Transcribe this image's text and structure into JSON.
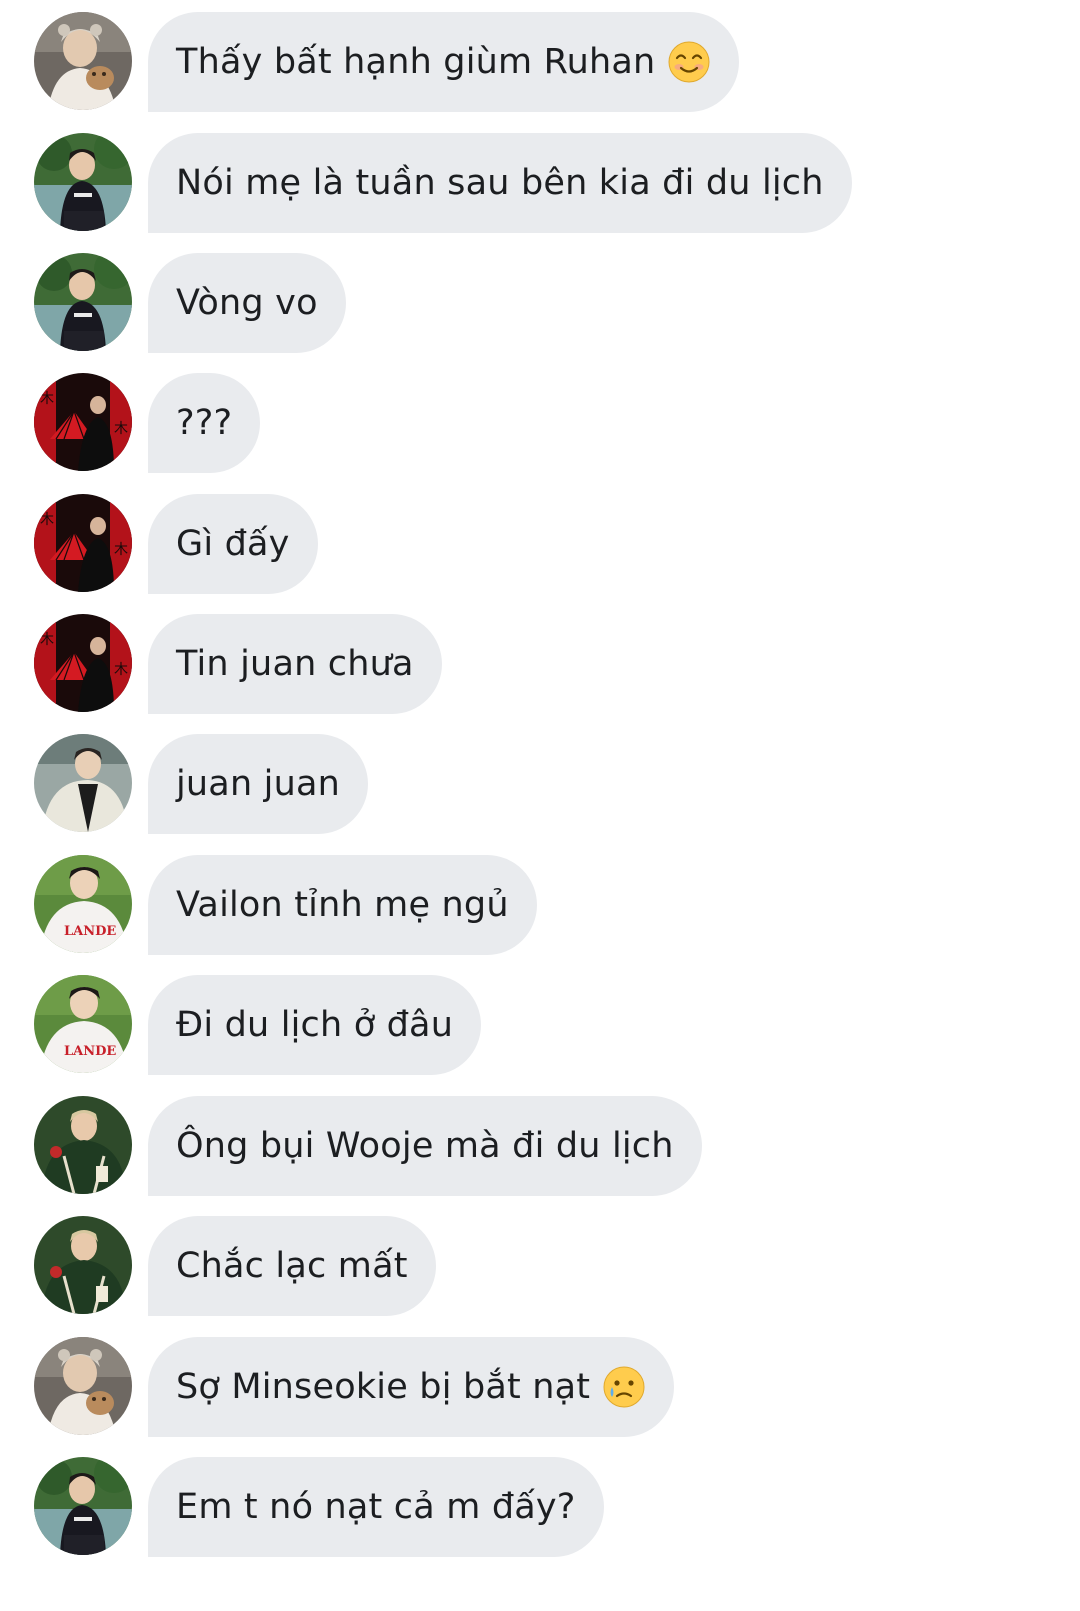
{
  "conversation": {
    "messages": [
      {
        "avatar": "avatar-cap-dog",
        "text": "Thấy bất hạnh giùm Ruhan",
        "emoji": "smiling-face-icon"
      },
      {
        "avatar": "avatar-park-black",
        "text": "Nói mẹ là tuần sau bên kia đi du lịch",
        "emoji": ""
      },
      {
        "avatar": "avatar-park-black",
        "text": "Vòng vo",
        "emoji": ""
      },
      {
        "avatar": "avatar-red-fan",
        "text": "???",
        "emoji": ""
      },
      {
        "avatar": "avatar-red-fan",
        "text": "Gì đấy",
        "emoji": ""
      },
      {
        "avatar": "avatar-red-fan",
        "text": "Tin juan chưa",
        "emoji": ""
      },
      {
        "avatar": "avatar-white-jacket",
        "text": "juan juan",
        "emoji": ""
      },
      {
        "avatar": "avatar-landers-jersey",
        "text": "Vailon tỉnh mẹ ngủ",
        "emoji": ""
      },
      {
        "avatar": "avatar-landers-jersey",
        "text": "Đi du lịch ở đâu",
        "emoji": ""
      },
      {
        "avatar": "avatar-green-jacket",
        "text": "Ông bụi Wooje mà đi du lịch",
        "emoji": ""
      },
      {
        "avatar": "avatar-green-jacket",
        "text": "Chắc lạc mất",
        "emoji": ""
      },
      {
        "avatar": "avatar-cap-dog",
        "text": "Sợ Minseokie bị bắt nạt",
        "emoji": "crying-face-icon"
      },
      {
        "avatar": "avatar-park-black",
        "text": "Em t nó nạt cả m đấy?",
        "emoji": ""
      }
    ]
  },
  "colors": {
    "bubble": "#e9ebee",
    "text": "#1c1e21",
    "background": "#ffffff"
  }
}
